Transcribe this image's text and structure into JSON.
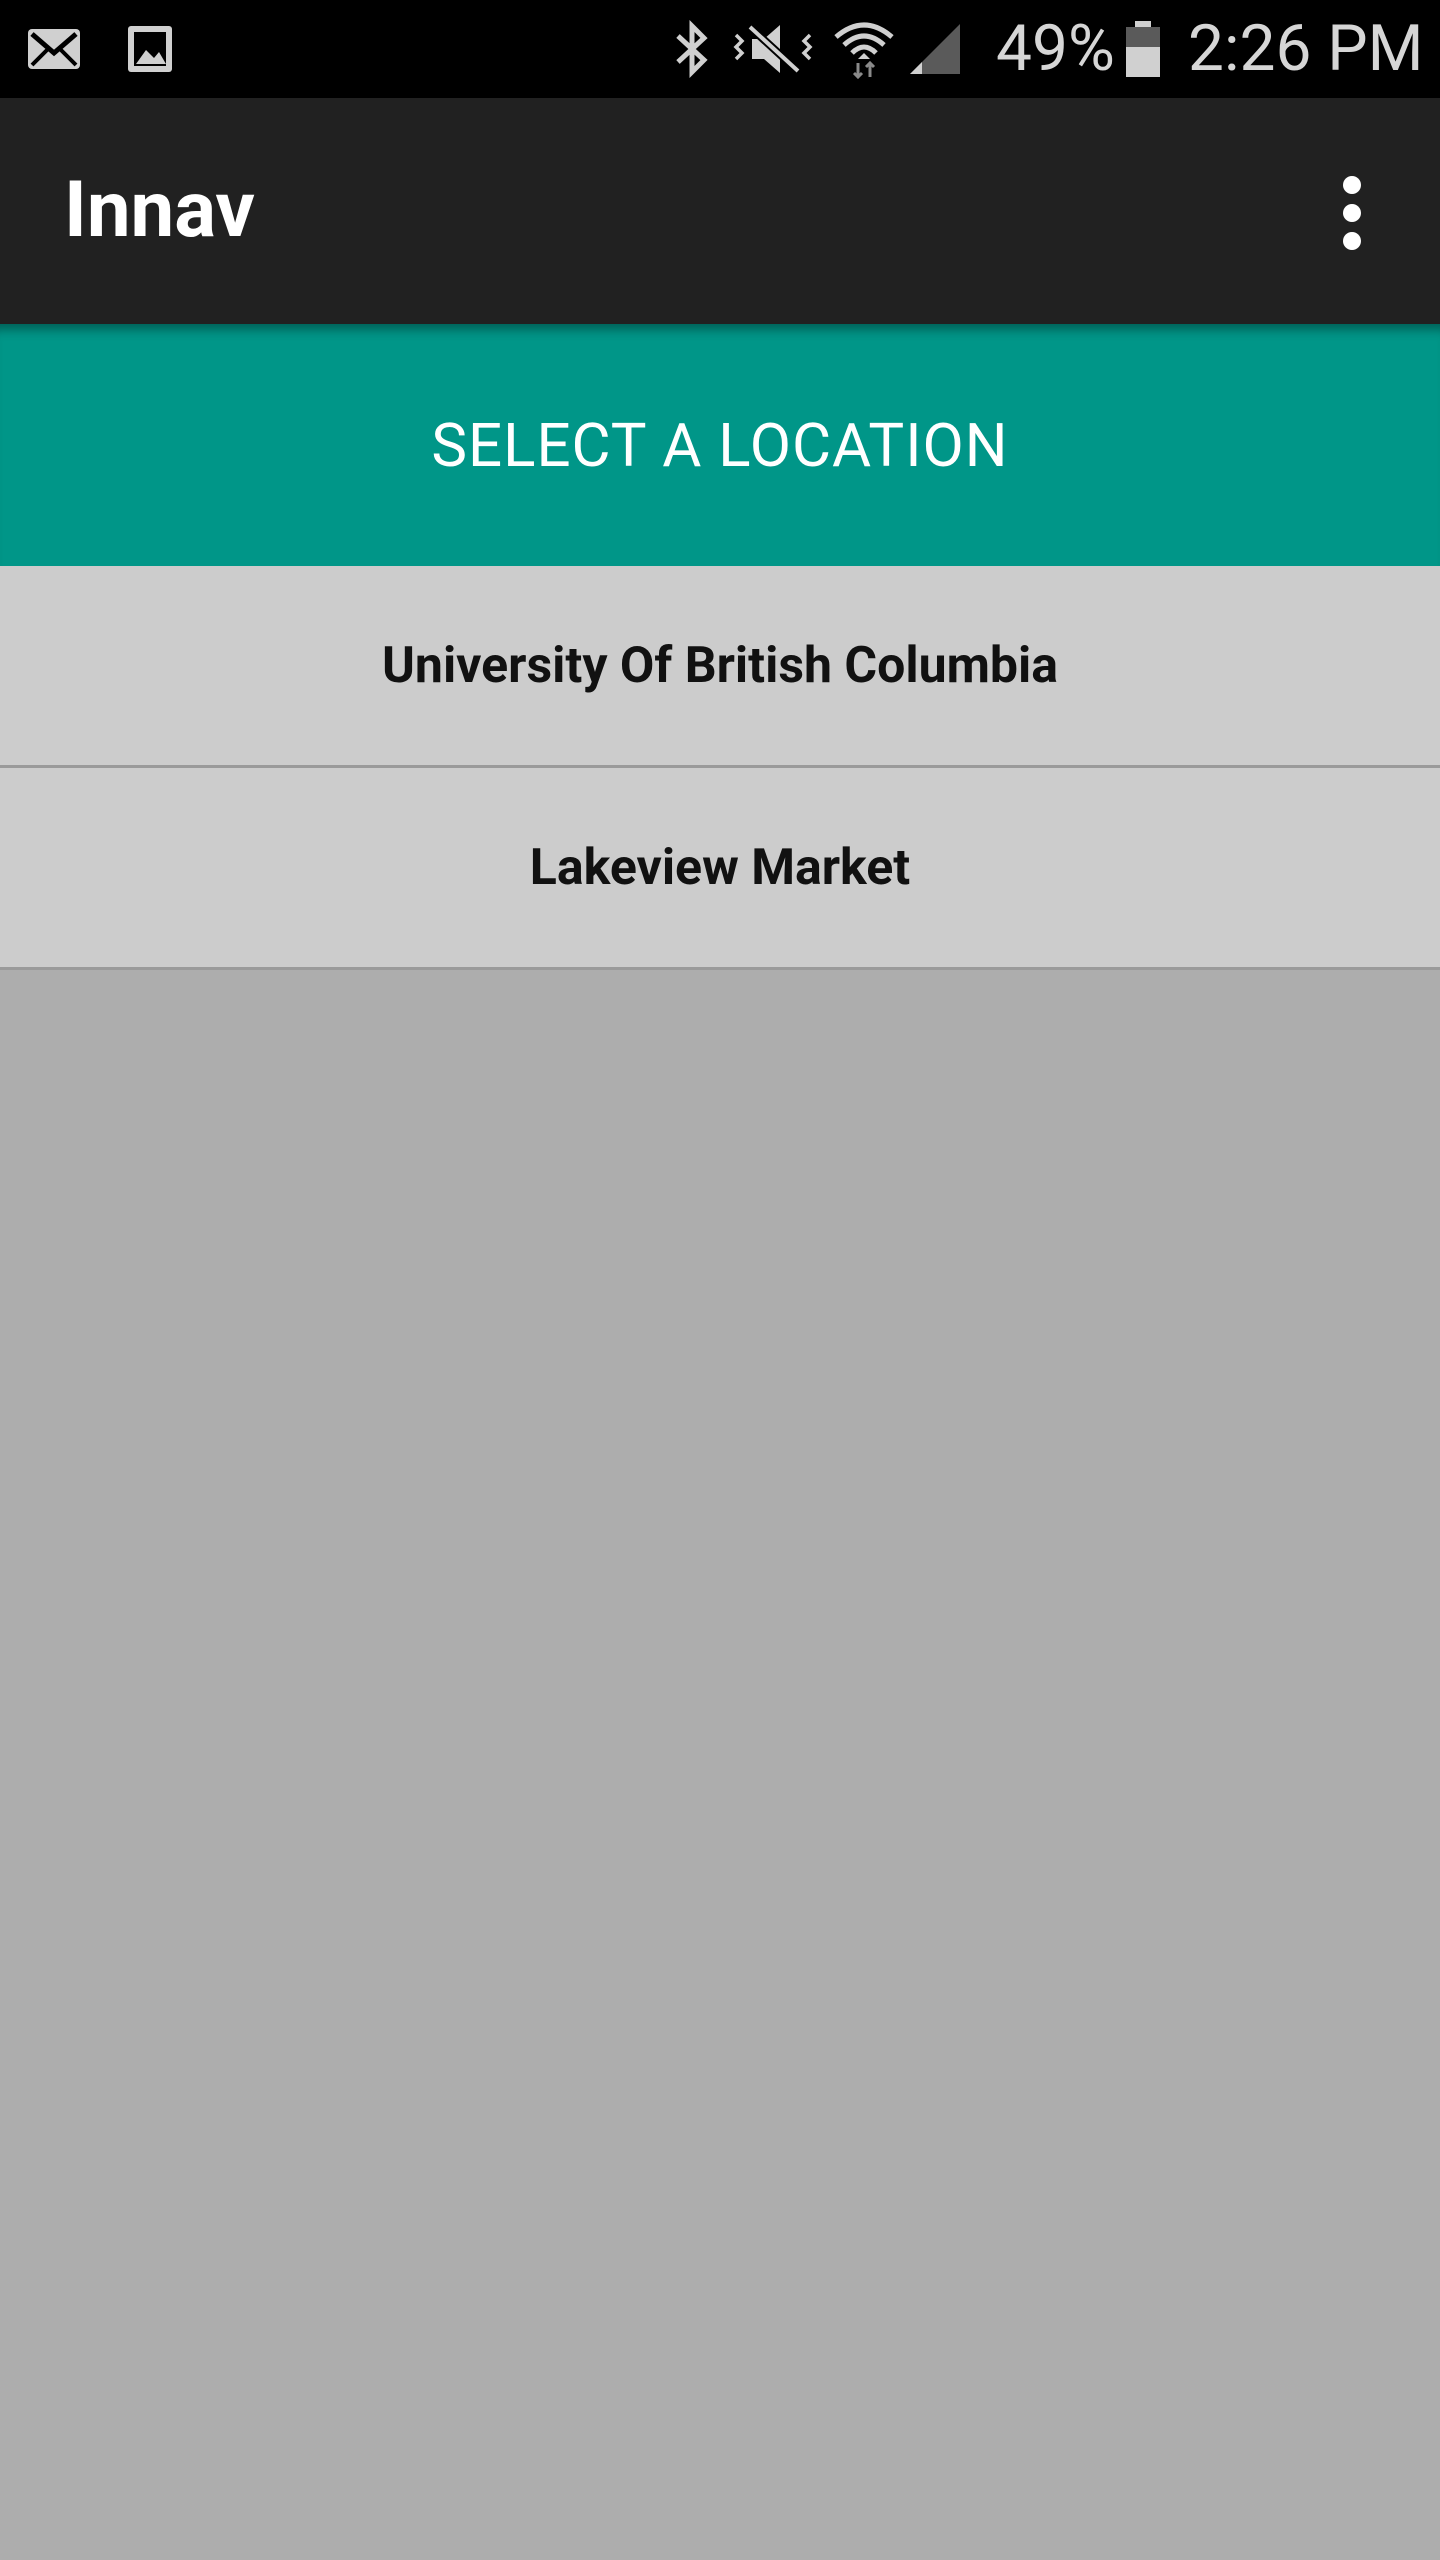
{
  "status_bar": {
    "icons": [
      "email-icon",
      "gallery-icon",
      "bluetooth-icon",
      "mute-vibrate-icon",
      "wifi-icon",
      "signal-icon",
      "battery-icon"
    ],
    "battery_percent": "49%",
    "time": "2:26 PM"
  },
  "app_bar": {
    "title": "Innav",
    "menu_icon": "more-vert-icon"
  },
  "header": {
    "label": "SELECT A LOCATION",
    "color": "#009688"
  },
  "locations": [
    {
      "label": "University Of British Columbia"
    },
    {
      "label": "Lakeview Market"
    }
  ]
}
